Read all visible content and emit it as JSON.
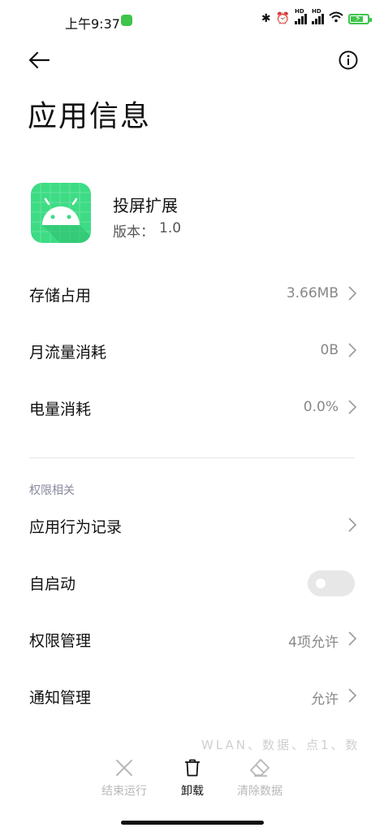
{
  "status_bar": {
    "time": "上午9:37",
    "hd1": "HD",
    "hd2": "HD"
  },
  "header": {
    "title": "应用信息"
  },
  "app": {
    "name": "投屏扩展",
    "version_label": "版本：",
    "version": "1.0"
  },
  "rows": [
    {
      "label": "存储占用",
      "value": "3.66MB"
    },
    {
      "label": "月流量消耗",
      "value": "0B"
    },
    {
      "label": "电量消耗",
      "value": "0.0%"
    }
  ],
  "section_title": "权限相关",
  "permission_rows": [
    {
      "label": "应用行为记录",
      "value": ""
    },
    {
      "label": "自启动",
      "toggle": false
    },
    {
      "label": "权限管理",
      "value": "4项允许"
    },
    {
      "label": "通知管理",
      "value": "允许"
    }
  ],
  "faded_text": "WLAN、数据、点1、数",
  "bottom_actions": [
    {
      "label": "结束运行",
      "icon": "close-icon",
      "enabled": false
    },
    {
      "label": "卸载",
      "icon": "trash-icon",
      "enabled": true
    },
    {
      "label": "清除数据",
      "icon": "eraser-icon",
      "enabled": false
    }
  ],
  "colors": {
    "accent_green": "#3ddc84",
    "disabled": "#b8b8b8",
    "value_gray": "#888888"
  }
}
